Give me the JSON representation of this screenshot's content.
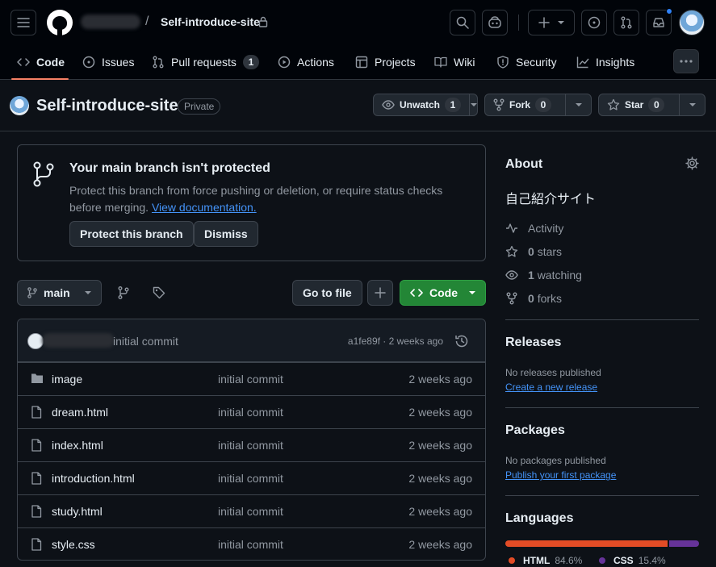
{
  "header": {
    "repo_name": "Self-introduce-site"
  },
  "repo_nav": {
    "tabs": [
      {
        "label": "Code"
      },
      {
        "label": "Issues"
      },
      {
        "label": "Pull requests",
        "count": "1"
      },
      {
        "label": "Actions"
      },
      {
        "label": "Projects"
      },
      {
        "label": "Wiki"
      },
      {
        "label": "Security"
      },
      {
        "label": "Insights"
      }
    ]
  },
  "repo_title": {
    "name": "Self-introduce-site",
    "visibility": "Private",
    "unwatch_label": "Unwatch",
    "watch_count": "1",
    "fork_label": "Fork",
    "fork_count": "0",
    "star_label": "Star",
    "star_count": "0"
  },
  "protect_banner": {
    "title": "Your main branch isn't protected",
    "description": "Protect this branch from force pushing or deletion, or require status checks before merging.",
    "link_label": "View documentation.",
    "protect_button": "Protect this branch",
    "dismiss_button": "Dismiss"
  },
  "file_nav": {
    "branch": "main",
    "go_to_file": "Go to file",
    "code_button": "Code"
  },
  "latest_commit": {
    "message": "initial commit",
    "hash_age": "a1fe89f · 2 weeks ago"
  },
  "files": [
    {
      "name": "image",
      "type": "folder",
      "message": "initial commit",
      "age": "2 weeks ago"
    },
    {
      "name": "dream.html",
      "type": "file",
      "message": "initial commit",
      "age": "2 weeks ago"
    },
    {
      "name": "index.html",
      "type": "file",
      "message": "initial commit",
      "age": "2 weeks ago"
    },
    {
      "name": "introduction.html",
      "type": "file",
      "message": "initial commit",
      "age": "2 weeks ago"
    },
    {
      "name": "study.html",
      "type": "file",
      "message": "initial commit",
      "age": "2 weeks ago"
    },
    {
      "name": "style.css",
      "type": "file",
      "message": "initial commit",
      "age": "2 weeks ago"
    }
  ],
  "about": {
    "heading": "About",
    "description": "自己紹介サイト",
    "activity": "Activity",
    "stars_count": "0",
    "stars_label": "stars",
    "watching_count": "1",
    "watching_label": "watching",
    "forks_count": "0",
    "forks_label": "forks"
  },
  "releases": {
    "heading": "Releases",
    "empty": "No releases published",
    "link": "Create a new release"
  },
  "packages": {
    "heading": "Packages",
    "empty": "No packages published",
    "link": "Publish your first package"
  },
  "languages": {
    "heading": "Languages",
    "items": [
      {
        "name": "HTML",
        "percent": "84.6%",
        "value": 84.6,
        "color": "#e34c26"
      },
      {
        "name": "CSS",
        "percent": "15.4%",
        "value": 15.4,
        "color": "#663399"
      }
    ]
  }
}
